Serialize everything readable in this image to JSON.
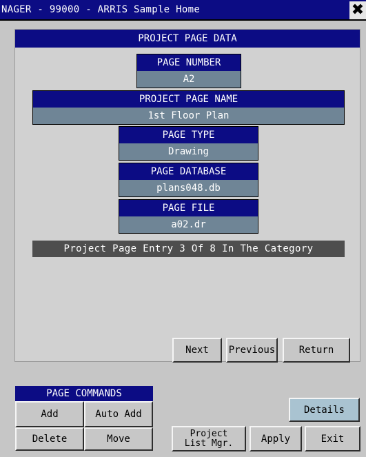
{
  "window": {
    "title": "NAGER - 99000 - ARRIS Sample Home",
    "close_glyph": "✖"
  },
  "panel": {
    "header": "PROJECT PAGE DATA",
    "fields": {
      "page_number": {
        "label": "PAGE NUMBER",
        "value": "A2"
      },
      "project_page_name": {
        "label": "PROJECT PAGE NAME",
        "value": "1st Floor Plan"
      },
      "page_type": {
        "label": "PAGE TYPE",
        "value": "Drawing"
      },
      "page_database": {
        "label": "PAGE DATABASE",
        "value": "plans048.db"
      },
      "page_file": {
        "label": "PAGE FILE",
        "value": "a02.dr"
      }
    },
    "entry_status": "Project Page Entry 3 Of 8 In The Category",
    "nav": {
      "next": "Next",
      "previous": "Previous",
      "return": "Return"
    }
  },
  "commands": {
    "header": "PAGE COMMANDS",
    "add": "Add",
    "auto_add": "Auto Add",
    "delete": "Delete",
    "move": "Move"
  },
  "footer": {
    "project_list_mgr": "Project\nList Mgr.",
    "apply": "Apply",
    "exit": "Exit",
    "details": "Details"
  },
  "colors": {
    "title_blue": "#0c0c84",
    "value_slate": "#6f8596",
    "background_gray": "#c6c6c6",
    "details_highlight": "#a9c3d1"
  }
}
